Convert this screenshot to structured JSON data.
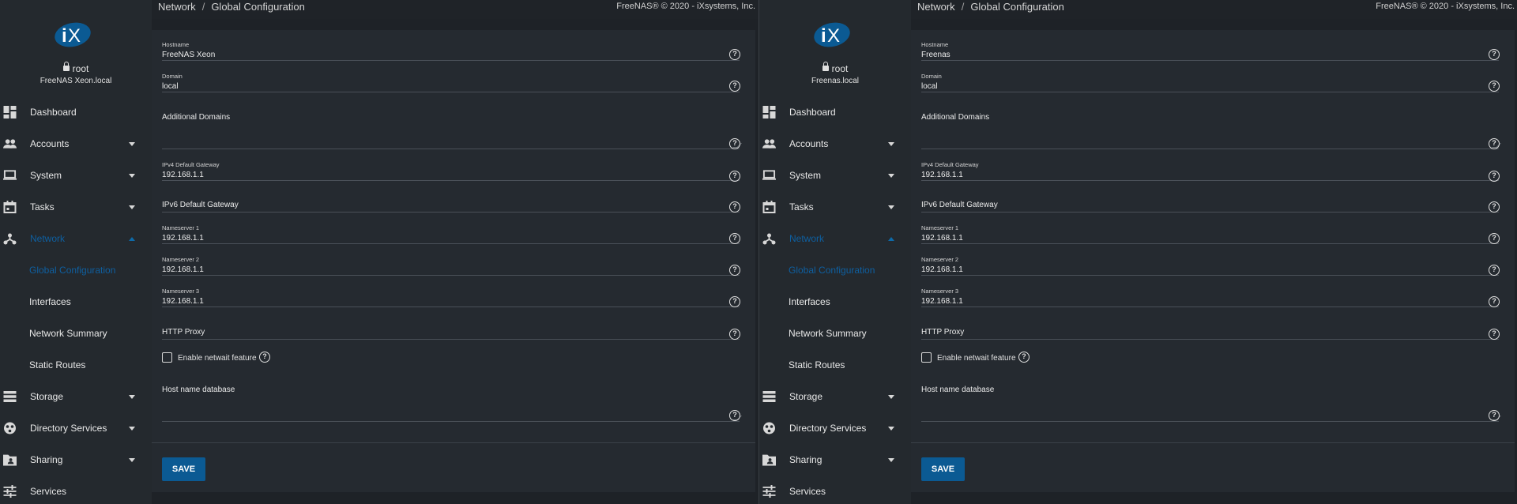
{
  "breadcrumb": {
    "parent": "Network",
    "sep": "/",
    "current": "Global Configuration"
  },
  "copyright": "FreeNAS® © 2020 - iXsystems, Inc.",
  "logo_text": "iX",
  "user": "root",
  "nav": {
    "dashboard": "Dashboard",
    "accounts": "Accounts",
    "system": "System",
    "tasks": "Tasks",
    "network": "Network",
    "global_configuration": "Global Configuration",
    "interfaces": "Interfaces",
    "network_summary": "Network Summary",
    "static_routes": "Static Routes",
    "storage": "Storage",
    "directory_services": "Directory Services",
    "sharing": "Sharing",
    "services": "Services"
  },
  "labels": {
    "hostname": "Hostname",
    "domain": "Domain",
    "additional_domains": "Additional Domains",
    "ipv4_gateway": "IPv4 Default Gateway",
    "ipv6_gateway": "IPv6 Default Gateway",
    "nameserver1": "Nameserver 1",
    "nameserver2": "Nameserver 2",
    "nameserver3": "Nameserver 3",
    "http_proxy": "HTTP Proxy",
    "netwait": "Enable netwait feature",
    "host_db": "Host name database",
    "save": "SAVE",
    "help": "?"
  },
  "screens": [
    {
      "hostname_display": "FreeNAS Xeon.local",
      "values": {
        "hostname": "FreeNAS Xeon",
        "domain": "local",
        "ipv4_gateway": "192.168.1.1",
        "nameserver1": "192.168.1.1",
        "nameserver2": "192.168.1.1",
        "nameserver3": "192.168.1.1"
      }
    },
    {
      "hostname_display": "Freenas.local",
      "values": {
        "hostname": "Freenas",
        "domain": "local",
        "ipv4_gateway": "192.168.1.1",
        "nameserver1": "192.168.1.1",
        "nameserver2": "192.168.1.1",
        "nameserver3": "192.168.1.1"
      }
    }
  ],
  "colors": {
    "accent": "#0e5fa0",
    "save_button": "#0b5a93",
    "sidebar": "#24292e"
  }
}
